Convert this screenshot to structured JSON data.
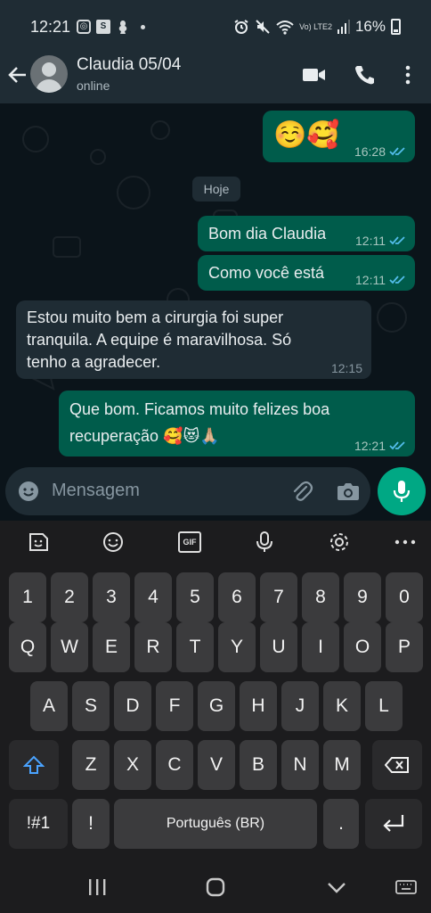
{
  "status_bar": {
    "time": "12:21",
    "app_icons": [
      "instagram-icon",
      "s-icon",
      "notification-icon"
    ],
    "network_label": "Vo) LTE2",
    "battery": "16%"
  },
  "header": {
    "contact_name": "Claudia 05/04",
    "contact_status": "online"
  },
  "chat": {
    "date_separator": "Hoje",
    "messages": [
      {
        "direction": "out",
        "text": "☺️🥰",
        "time": "16:28",
        "read": true
      },
      {
        "direction": "out",
        "text": "Bom dia Claudia",
        "time": "12:11",
        "read": true
      },
      {
        "direction": "out",
        "text": "Como você está",
        "time": "12:11",
        "read": true
      },
      {
        "direction": "in",
        "lines": [
          "Estou muito bem a cirurgia foi super",
          "tranquila. A equipe é maravilhosa. Só",
          "tenho a agradecer."
        ],
        "time": "12:15"
      },
      {
        "direction": "out",
        "lines": [
          "Que bom. Ficamos muito felizes boa",
          "recuperação 🥰😻🙏🏼"
        ],
        "time": "12:21",
        "read": true
      }
    ]
  },
  "input": {
    "placeholder": "Mensagem"
  },
  "keyboard": {
    "toolbar": [
      "sticker-icon",
      "emoji-icon",
      "gif-icon",
      "voice-icon",
      "settings-icon",
      "more-icon"
    ],
    "gif_label": "GIF",
    "row_numbers": [
      "1",
      "2",
      "3",
      "4",
      "5",
      "6",
      "7",
      "8",
      "9",
      "0"
    ],
    "row_q": [
      "Q",
      "W",
      "E",
      "R",
      "T",
      "Y",
      "U",
      "I",
      "O",
      "P"
    ],
    "row_a": [
      "A",
      "S",
      "D",
      "F",
      "G",
      "H",
      "J",
      "K",
      "L"
    ],
    "row_z": [
      "Z",
      "X",
      "C",
      "V",
      "B",
      "N",
      "M"
    ],
    "symbols_label": "!#1",
    "exclaim_label": "!",
    "space_label": "Português (BR)",
    "period_label": "."
  },
  "colors": {
    "outgoing_bubble": "#005c4b",
    "incoming_bubble": "#1f2c34",
    "accent": "#00a884",
    "read_ticks": "#53bdeb",
    "shift_active": "#4aa3ff"
  }
}
